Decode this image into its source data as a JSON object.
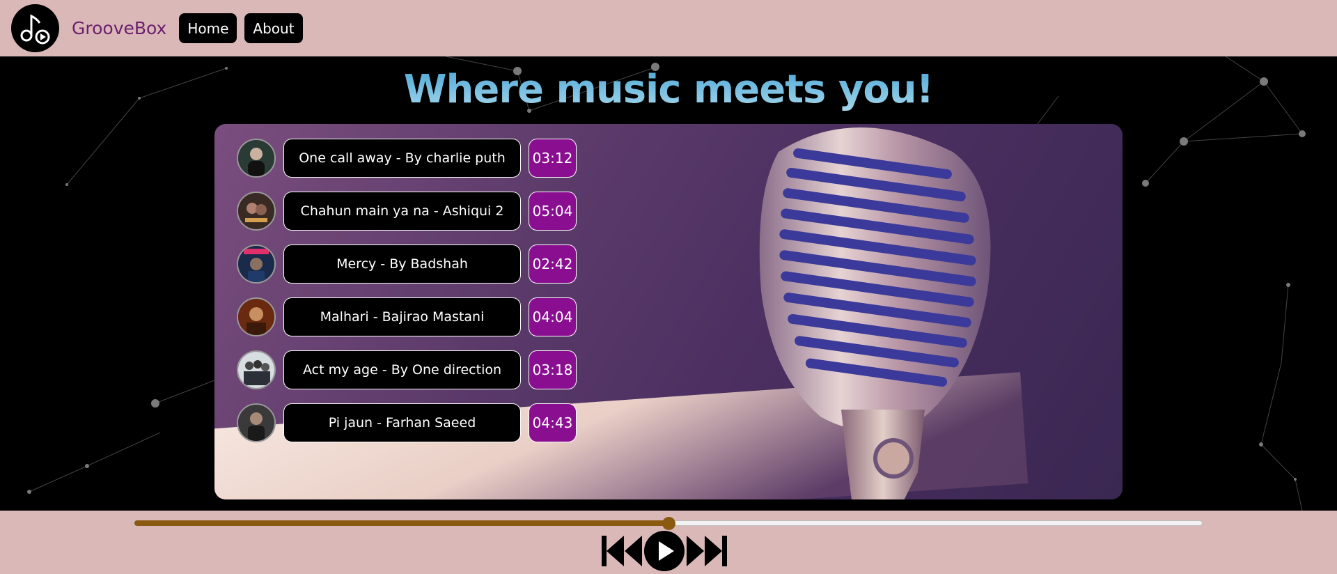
{
  "navbar": {
    "brand": "GrooveBox",
    "home_label": "Home",
    "about_label": "About",
    "logo_icon": "music-note-play-icon"
  },
  "main": {
    "headline": "Where music meets you!",
    "songs": [
      {
        "title": "One call away - By charlie puth",
        "duration": "03:12"
      },
      {
        "title": "Chahun main ya na - Ashiqui 2",
        "duration": "05:04"
      },
      {
        "title": "Mercy - By Badshah",
        "duration": "02:42"
      },
      {
        "title": "Malhari - Bajirao Mastani",
        "duration": "04:04"
      },
      {
        "title": "Act my age - By One direction",
        "duration": "03:18"
      },
      {
        "title": "Pi jaun - Farhan Saeed",
        "duration": "04:43"
      }
    ]
  },
  "player": {
    "progress": 0.5,
    "icons": [
      "previous-icon",
      "play-icon",
      "next-icon"
    ]
  },
  "colors": {
    "navbar_bg": "#dbb8b8",
    "brand": "#6a1f6e",
    "duration_bg": "#8a0f90",
    "progress": "#8a5a10"
  }
}
